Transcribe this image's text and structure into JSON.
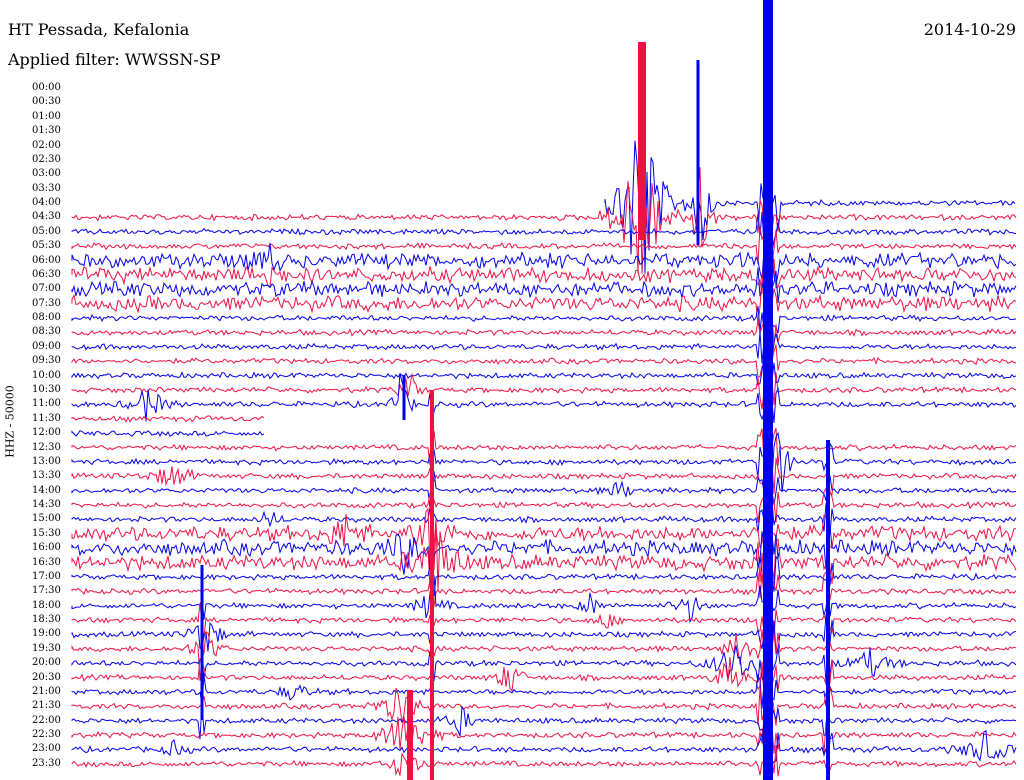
{
  "header": {
    "title": "HT Pessada, Kefalonia",
    "filter": "Applied filter: WWSSN-SP",
    "date": "2014-10-29"
  },
  "axis": {
    "ylabel": "HHZ - 50000"
  },
  "colors": {
    "odd": "#0000ee",
    "even": "#ee1144",
    "text": "#000000"
  },
  "chart_data": {
    "type": "line",
    "title": "HT Pessada, Kefalonia",
    "ylabel": "HHZ - 50000",
    "xlabel": "",
    "lines": [
      "00:00",
      "00:30",
      "01:00",
      "01:30",
      "02:00",
      "02:30",
      "03:00",
      "03:30",
      "04:00",
      "04:30",
      "05:00",
      "05:30",
      "06:00",
      "06:30",
      "07:00",
      "07:30",
      "08:00",
      "08:30",
      "09:00",
      "09:30",
      "10:00",
      "10:30",
      "11:00",
      "11:30",
      "12:00",
      "12:30",
      "13:00",
      "13:30",
      "14:00",
      "14:30",
      "15:00",
      "15:30",
      "16:00",
      "16:30",
      "17:00",
      "17:30",
      "18:00",
      "18:30",
      "19:00",
      "19:30",
      "20:00",
      "20:30",
      "21:00",
      "21:30",
      "22:00",
      "22:30",
      "23:00",
      "23:30"
    ],
    "series_desc": "helicorder trace per 30-minute line, alternating blue/red; data begins at 04:00 near x=605 on the top trace"
  }
}
